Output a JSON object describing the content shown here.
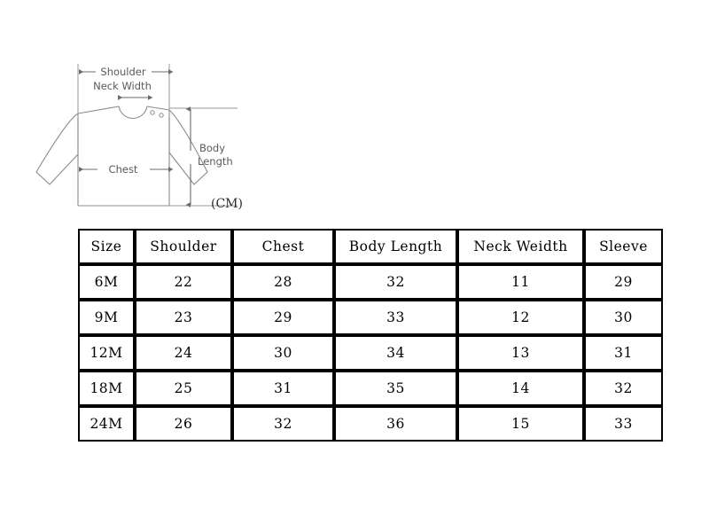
{
  "diagram": {
    "name": "baby-top-measurement-diagram",
    "stroke_color": "#8c8c8c",
    "label_color": "#5a5a5a",
    "labels": {
      "shoulder": "Shoulder",
      "neck_width": "Neck Width",
      "chest": "Chest",
      "body_length_line1": "Body",
      "body_length_line2": "Length",
      "unit": "(CM)"
    }
  },
  "chart_data": {
    "type": "table",
    "title": "",
    "columns": [
      "Size",
      "Shoulder",
      "Chest",
      "Body Length",
      "Neck Weidth",
      "Sleeve"
    ],
    "rows": [
      [
        "6M",
        "22",
        "28",
        "32",
        "11",
        "29"
      ],
      [
        "9M",
        "23",
        "29",
        "33",
        "12",
        "30"
      ],
      [
        "12M",
        "24",
        "30",
        "34",
        "13",
        "31"
      ],
      [
        "18M",
        "25",
        "31",
        "35",
        "14",
        "32"
      ],
      [
        "24M",
        "26",
        "32",
        "36",
        "15",
        "33"
      ]
    ],
    "unit": "(CM)",
    "border_color": "#000000",
    "cell_background": "#ffffff"
  }
}
